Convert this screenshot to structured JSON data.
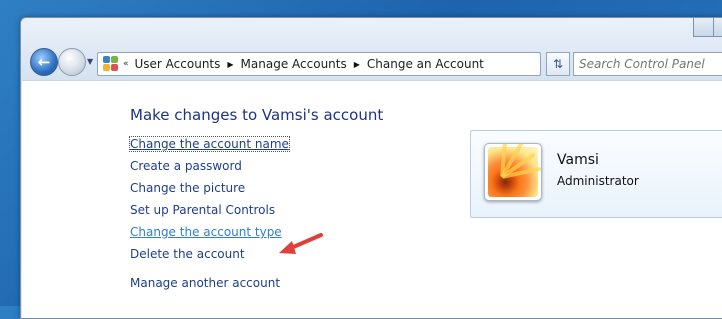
{
  "address_bar": {
    "overflow_chevron": "«",
    "crumbs": [
      "User Accounts",
      "Manage Accounts",
      "Change an Account"
    ]
  },
  "search": {
    "placeholder": "Search Control Panel"
  },
  "page": {
    "title": "Make changes to Vamsi's account",
    "links": [
      "Change the account name",
      "Create a password",
      "Change the picture",
      "Set up Parental Controls",
      "Change the account type",
      "Delete the account",
      "Manage another account"
    ]
  },
  "account": {
    "name": "Vamsi",
    "role": "Administrator"
  },
  "icons": {
    "back": "back-arrow-icon",
    "forward": "forward-arrow-icon",
    "refresh": "refresh-icon",
    "control_panel": "control-panel-icon",
    "avatar": "flower-picture-icon",
    "pointer": "red-arrow-icon"
  },
  "colors": {
    "link": "#1e3e8c",
    "link_hover": "#2f7fcf",
    "title": "#1e3287",
    "annotation_arrow": "#e0403a"
  }
}
